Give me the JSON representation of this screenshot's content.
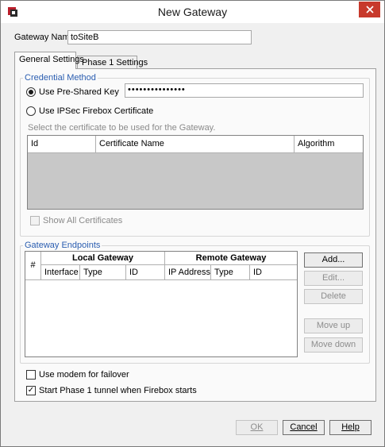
{
  "window": {
    "title": "New Gateway",
    "app_icon": "firebox-icon",
    "close_icon": "close-icon"
  },
  "gateway_name": {
    "label": "Gateway Name:",
    "value": "toSiteB"
  },
  "tabs": [
    {
      "label": "General Settings",
      "active": true
    },
    {
      "label": "Phase 1 Settings",
      "active": false
    }
  ],
  "credential_method": {
    "title": "Credential Method",
    "psk_label": "Use Pre-Shared Key",
    "psk_value": "•••••••••••••••",
    "cert_label": "Use IPSec Firebox Certificate",
    "cert_hint": "Select the certificate to be used for the Gateway.",
    "columns": [
      "Id",
      "Certificate Name",
      "Algorithm"
    ],
    "show_all_label": "Show All Certificates"
  },
  "gateway_endpoints": {
    "title": "Gateway Endpoints",
    "col_hash": "#",
    "local_group": "Local Gateway",
    "remote_group": "Remote Gateway",
    "local_cols": [
      "Interface",
      "Type",
      "ID"
    ],
    "remote_cols": [
      "IP Address",
      "Type",
      "ID"
    ],
    "buttons": {
      "add": "Add...",
      "edit": "Edit...",
      "delete": "Delete",
      "move_up": "Move up",
      "move_down": "Move down"
    }
  },
  "options": {
    "modem_label": "Use modem for failover",
    "modem_checked": false,
    "start_phase1_label": "Start Phase 1 tunnel when Firebox starts",
    "start_phase1_checked": true
  },
  "footer": {
    "ok": "OK",
    "cancel": "Cancel",
    "help": "Help"
  }
}
